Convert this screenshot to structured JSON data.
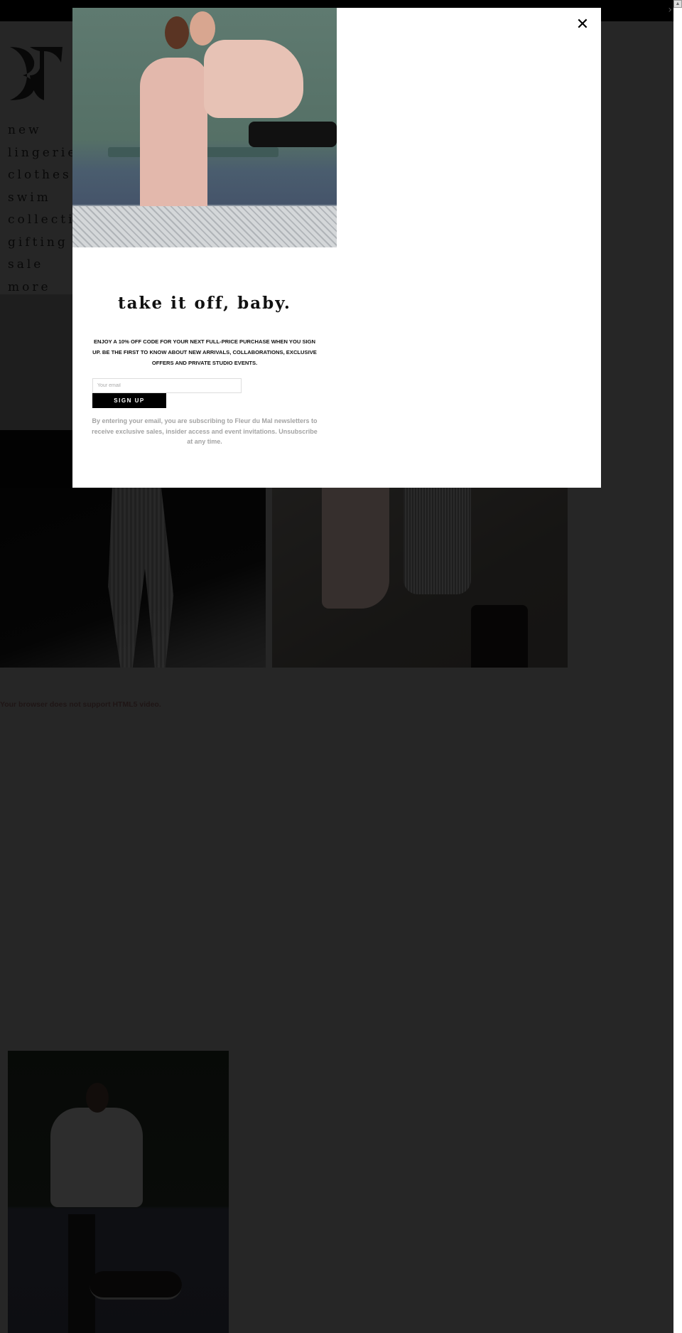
{
  "topbar": {
    "next_arrow": "›"
  },
  "scrollbar": {
    "up_arrow": "▲"
  },
  "header": {
    "logo": "Fleur du Mal monogram",
    "nav": [
      {
        "label": "new"
      },
      {
        "label": "lingerie"
      },
      {
        "label": "clothes"
      },
      {
        "label": "swim"
      },
      {
        "label": "collection"
      },
      {
        "label": "gifting"
      },
      {
        "label": "sale"
      },
      {
        "label": "more"
      }
    ]
  },
  "main": {
    "video_fallback": "Your browser does not support HTML5 video."
  },
  "modal": {
    "close_icon": "✕",
    "title": "take it off, baby.",
    "description": "ENJOY A 10% OFF CODE FOR YOUR NEXT FULL-PRICE PURCHASE WHEN YOU SIGN UP. BE THE FIRST TO KNOW ABOUT NEW ARRIVALS, COLLABORATIONS, EXCLUSIVE OFFERS AND PRIVATE STUDIO EVENTS.",
    "email_placeholder": "Your email",
    "email_value": "",
    "signup_label": "SIGN UP",
    "fine_print": "By entering your email, you are subscribing to Fleur du Mal newsletters to receive exclusive sales, insider access and event invitations. Unsubscribe at any time."
  },
  "colors": {
    "overlay": "#4d4d4d",
    "button": "#000000",
    "fine_print": "#a3a3a3"
  }
}
